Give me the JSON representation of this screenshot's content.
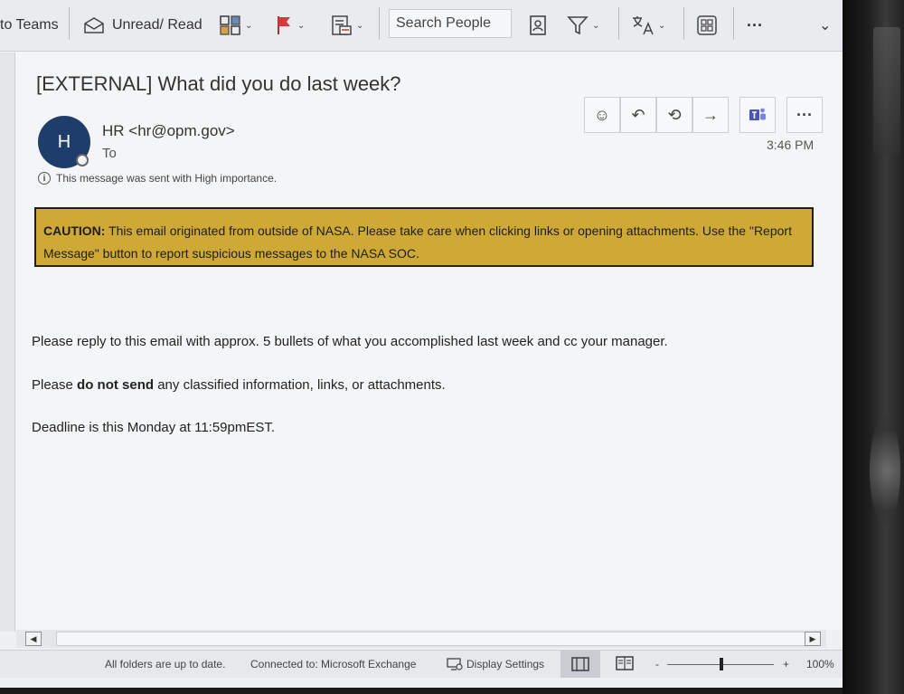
{
  "toolbar": {
    "teams_label": "to Teams",
    "unread_read_label": "Unread/ Read",
    "search_placeholder": "Search People"
  },
  "message": {
    "subject": "[EXTERNAL] What did you do last week?",
    "avatar_initial": "H",
    "sender": "HR <hr@opm.gov>",
    "to_label": "To",
    "time": "3:46 PM",
    "importance_note": "This message was sent with High importance.",
    "caution_prefix": "CAUTION:",
    "caution_text": " This email originated from outside of NASA.  Please take care when clicking links or opening attachments.  Use the \"Report Message\" button to report suspicious messages to the NASA SOC.",
    "body_line1": "Please reply to this email with approx. 5 bullets of what you accomplished last week and cc your manager.",
    "body_line2_a": "Please ",
    "body_line2_b": "do not send",
    "body_line2_c": " any classified information, links, or attachments.",
    "body_line3": "Deadline is this Monday at 11:59pmEST."
  },
  "statusbar": {
    "sync": "All folders are up to date.",
    "connection": "Connected to: Microsoft Exchange",
    "display_settings": "Display Settings",
    "zoom_minus": "-",
    "zoom_plus": "+",
    "zoom_level": "100%"
  },
  "icons": {
    "ellipsis": "···",
    "emoji": "☺",
    "reply": "↶",
    "reply_all": "⟲",
    "forward": "→",
    "info": "i",
    "chevron_down": "⌄"
  },
  "colors": {
    "caution_bg": "#cfa935",
    "avatar_bg": "#1f3d6b"
  }
}
